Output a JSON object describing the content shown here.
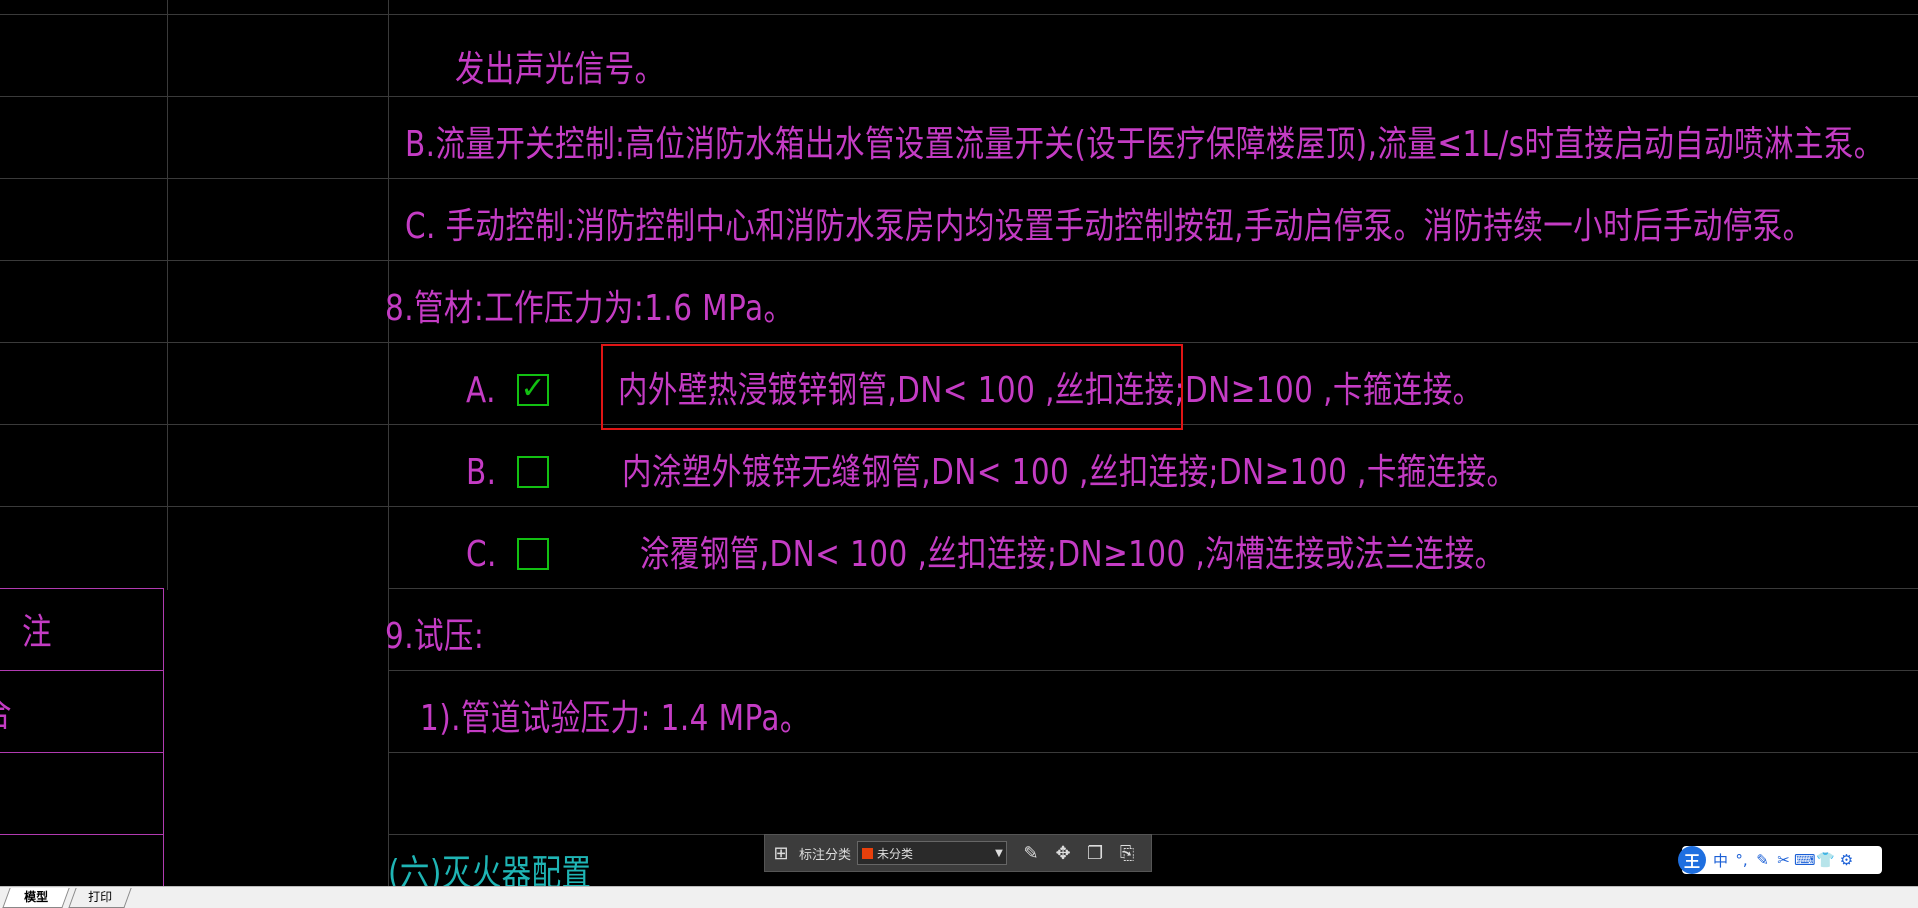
{
  "drawing": {
    "line_top_partial": "",
    "line_signal": "发出声光信号。",
    "line_b": "B.流量开关控制:高位消防水箱出水管设置流量开关(设于医疗保障楼屋顶),流量≤1L/s时直接启动自动喷淋主泵。",
    "line_c": "C. 手动控制:消防控制中心和消防水泵房内均设置手动控制按钮,手动启停泵。消防持续一小时后手动停泵。",
    "line_8": "8.管材:工作压力为:1.6 MPa。",
    "option_a_prefix": "A.",
    "option_a_checkmark": "✓",
    "option_a_text": "内外壁热浸镀锌钢管,DN< 100  ,丝扣连接;DN≥100  ,卡箍连接。",
    "option_b_prefix": "B.",
    "option_b_text": "内涂塑外镀锌无缝钢管,DN< 100  ,丝扣连接;DN≥100  ,卡箍连接。",
    "option_c_prefix": "C.",
    "option_c_text": "涂覆钢管,DN< 100  ,丝扣连接;DN≥100  ,沟槽连接或法兰连接。",
    "line_9": "9.试压:",
    "line_9_1": "1).管道试验压力:     1.4  MPa。",
    "section_6": "(六)灭火器配置",
    "left_table_note": "注",
    "left_table_partial": "合"
  },
  "toolbar": {
    "label": "标注分类",
    "select_value": "未分类",
    "select_color": "#e8400c"
  },
  "ime": {
    "logo": "王",
    "items": [
      "中",
      "°,",
      "✎",
      "✂",
      "⌨",
      "👕",
      "⚙"
    ]
  },
  "tabs": {
    "model": "模型",
    "print": "打印"
  },
  "colors": {
    "text": "#c43cc4",
    "heading": "#1fb5b5",
    "checkbox": "#12c012",
    "highlight": "#e01515"
  }
}
